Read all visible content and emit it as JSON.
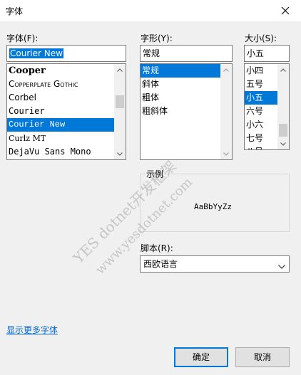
{
  "window": {
    "title": "字体"
  },
  "font": {
    "label": "字体(F):",
    "value": "Courier New",
    "items": [
      {
        "text": "Cooper",
        "family": "\"DejaVu Serif\", serif",
        "weight": "bold",
        "size": "13px",
        "variant": "normal"
      },
      {
        "text": "Copperplate Gothic",
        "family": "\"DejaVu Sans\", sans-serif",
        "weight": "normal",
        "size": "12px",
        "variant": "small-caps"
      },
      {
        "text": "Corbel",
        "family": "\"DejaVu Sans\", sans-serif",
        "weight": "normal",
        "size": "12px",
        "variant": "normal"
      },
      {
        "text": "Courier",
        "family": "\"DejaVu Sans Mono\", monospace",
        "weight": "normal",
        "size": "12px",
        "variant": "normal"
      },
      {
        "text": "Courier New",
        "family": "\"Liberation Mono\", monospace",
        "weight": "normal",
        "size": "12px",
        "variant": "normal",
        "selected": true
      },
      {
        "text": "Curlz MT",
        "family": "\"DejaVu Serif\", serif",
        "weight": "normal",
        "size": "11px",
        "variant": "normal"
      },
      {
        "text": "DejaVu Sans Mono",
        "family": "\"DejaVu Sans Mono\", monospace",
        "weight": "normal",
        "size": "12px",
        "variant": "normal"
      }
    ]
  },
  "style": {
    "label": "字形(Y):",
    "value": "常规",
    "items": [
      {
        "text": "常规",
        "selected": true
      },
      {
        "text": "斜体"
      },
      {
        "text": "粗体"
      },
      {
        "text": "粗斜体"
      }
    ]
  },
  "size": {
    "label": "大小(S):",
    "value": "小五",
    "items": [
      {
        "text": "小四"
      },
      {
        "text": "五号"
      },
      {
        "text": "小五",
        "selected": true
      },
      {
        "text": "六号"
      },
      {
        "text": "小六"
      },
      {
        "text": "七号"
      },
      {
        "text": "八号"
      }
    ]
  },
  "sample": {
    "label": "示例",
    "text": "AaBbYyZz"
  },
  "script": {
    "label": "脚本(R):",
    "value": "西欧语言"
  },
  "more_fonts_link": "显示更多字体",
  "buttons": {
    "ok": "确定",
    "cancel": "取消"
  },
  "watermark": {
    "line1": "YES dotnet开发框架",
    "line2": "www.yesdotnet.com"
  },
  "colors": {
    "selection": "#0078d7",
    "link": "#0066cc",
    "default_button_border": "#0078d7"
  }
}
